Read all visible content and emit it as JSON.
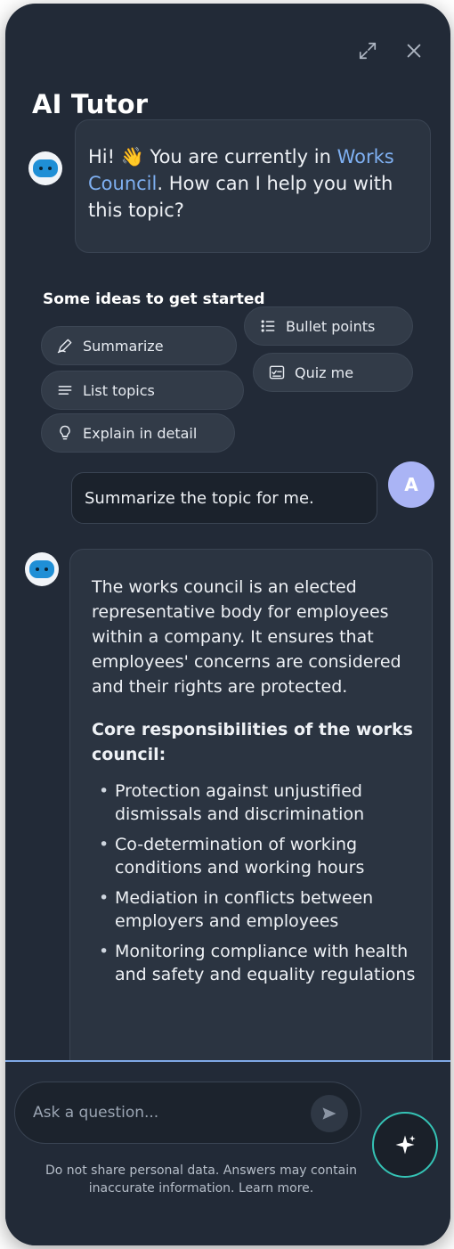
{
  "window": {
    "title": "AI Tutor",
    "expand_icon": "expand-icon",
    "close_icon": "close-icon"
  },
  "greeting": {
    "prefix": "Hi! 👋 You are currently in",
    "topic": "Works Council",
    "suffix": ". How can I help you with this topic?"
  },
  "ideas": {
    "title": "Some ideas to get started",
    "chips": [
      {
        "label": "Summarize",
        "icon": "pen-icon"
      },
      {
        "label": "Bullet points",
        "icon": "list-bullets-icon"
      },
      {
        "label": "List topics",
        "icon": "lines-icon"
      },
      {
        "label": "Quiz me",
        "icon": "quiz-icon"
      },
      {
        "label": "Explain in detail",
        "icon": "lightbulb-icon"
      }
    ]
  },
  "user_message": {
    "text": "Summarize the topic for me.",
    "avatar_initial": "A",
    "avatar_color": "#aab4f5"
  },
  "answer": {
    "intro": "The works council is an elected representative body for employees within a company. It ensures that employees' concerns are considered and their rights are protected.",
    "heading": "Core responsibilities of the works council:",
    "bullets": [
      "Protection against unjustified dismissals and discrimination",
      "Co-determination of working conditions and working hours",
      "Mediation in conflicts between employers and employees",
      "Monitoring compliance with health and safety and equality regulations"
    ]
  },
  "input": {
    "placeholder": "Ask a question...",
    "send_icon": "send-icon",
    "magic_icon": "sparkle-icon"
  },
  "disclaimer": "Do not share personal data. Answers may contain inaccurate information. Learn more.",
  "colors": {
    "panel_bg": "#222a37",
    "link": "#7fb0f2",
    "accent_teal": "#35c3b5",
    "divider": "#7fa8e6"
  }
}
